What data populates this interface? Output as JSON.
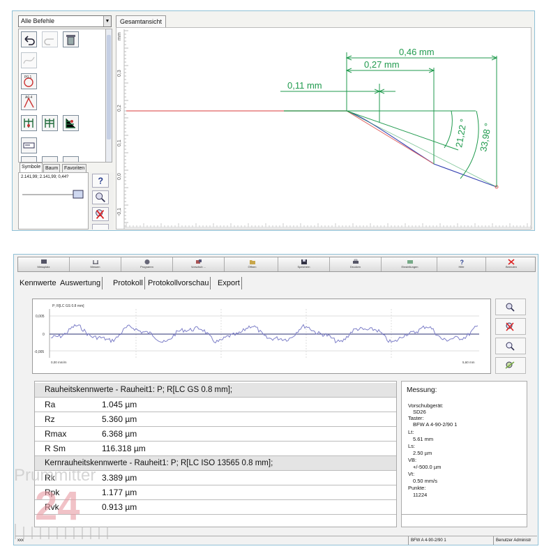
{
  "top_app": {
    "command_filter": "Alle Befehle",
    "view_tab": "Gesamtansicht",
    "panel_tabs": [
      "Symbole",
      "Baum",
      "Favoriten"
    ],
    "coords_readout": "2.141,99; 2.141,99; 0,44?",
    "plot": {
      "y_axis_unit": "mm",
      "y_ticks": [
        "0,3",
        "0,2",
        "0,1",
        "0,0",
        "-0,1"
      ],
      "dim_small": "0,11 mm",
      "dim_medium": "0,27 mm",
      "dim_large": "0,46 mm",
      "angle_small": "21,22 °",
      "angle_large": "33,98 °"
    }
  },
  "bottom_app": {
    "toolbar": [
      "Messplatz",
      "Messen",
      "Programm",
      "Vorschub ...",
      "Öffnen",
      "Speichern",
      "Drucken",
      "Einstellungen",
      "Hilfe",
      "Beenden"
    ],
    "tabs": [
      "Kennwerte",
      "Auswertung",
      "Protokoll",
      "Protokollvorschau",
      "Export"
    ],
    "profile": {
      "title": "P; R[LC GS 0.8 mm]",
      "y_ticks": [
        "0,005",
        "0",
        "-0,005"
      ],
      "x_start": "0,00 mm/m",
      "x_end": "5,60 mm"
    },
    "roughness": {
      "header": "Rauheitskennwerte - Rauheit1: P; R[LC GS 0.8 mm];",
      "rows": [
        {
          "name": "Ra",
          "value": "1.045 µm"
        },
        {
          "name": "Rz",
          "value": "5.360 µm"
        },
        {
          "name": "Rmax",
          "value": "6.368 µm"
        },
        {
          "name": "R Sm",
          "value": "116.318 µm"
        }
      ]
    },
    "core_roughness": {
      "header": "Kernrauheitskennwerte - Rauheit1: P; R[LC ISO 13565 0.8 mm];",
      "rows": [
        {
          "name": "Rk",
          "value": "3.389 µm"
        },
        {
          "name": "Rpk",
          "value": "1.177 µm"
        },
        {
          "name": "Rvk",
          "value": "0.913 µm"
        }
      ]
    },
    "measurement": {
      "title": "Messung:",
      "lines": [
        "Vorschubgerät:",
        "SD26",
        "Taster:",
        "BFW A 4-90-2/90 1",
        "Lt:",
        "5.61 mm",
        "Ls:",
        "2.50 µm",
        "VB:",
        "+/-500.0 µm",
        "Vt:",
        "0.50 mm/s",
        "Punkte:",
        "11224"
      ]
    },
    "status": {
      "left": "xxx",
      "probe": "BFW A 4-90-2/90 1",
      "user": "Benutzer Administr"
    }
  },
  "watermark": {
    "brand": "Prummitter",
    "number": "24"
  },
  "colors": {
    "accent_green": "#1f9a4d",
    "profile_red": "#e06060",
    "profile_blue": "#3340b0",
    "frame_blue": "#8fc0d6"
  }
}
